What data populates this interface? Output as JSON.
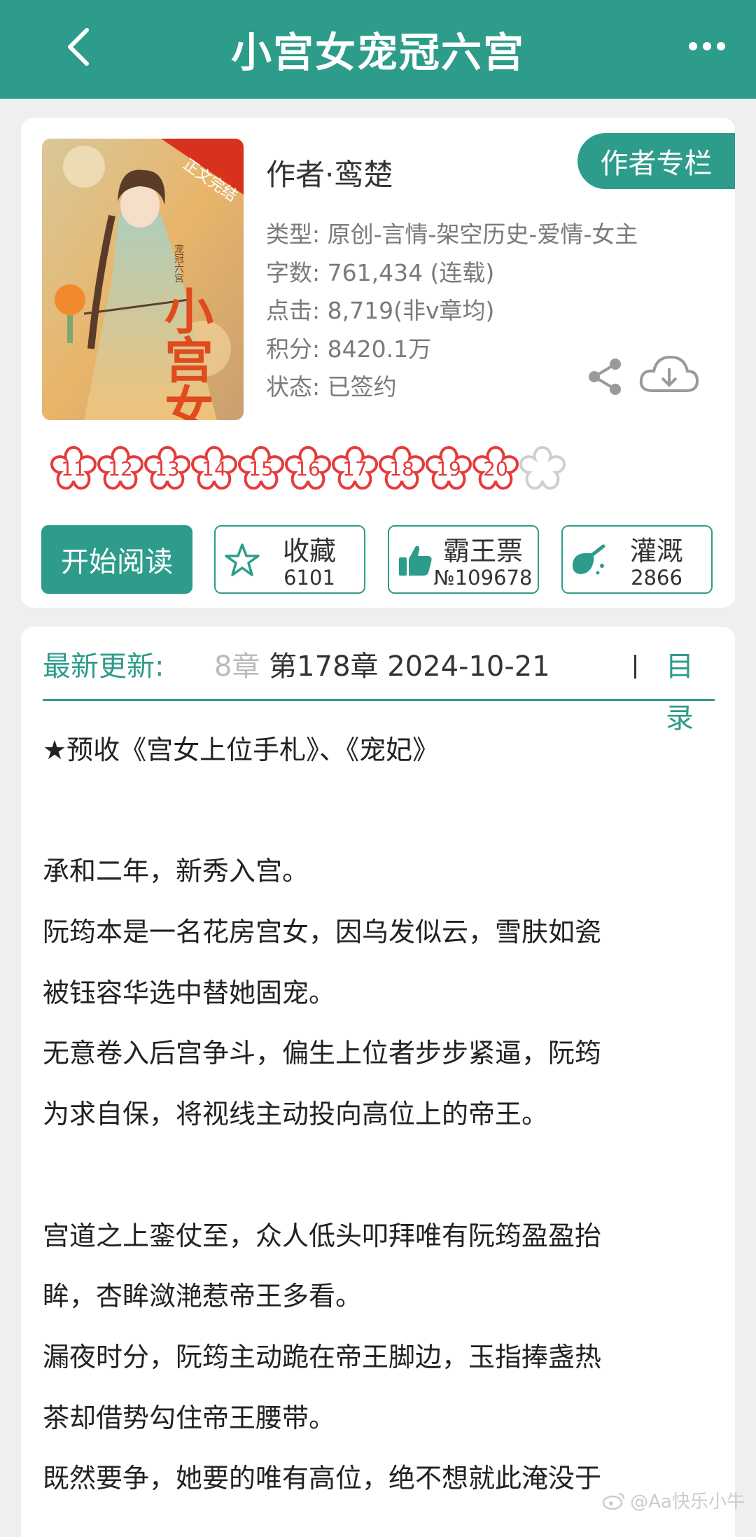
{
  "header": {
    "title": "小宫女宠冠六宫"
  },
  "book": {
    "cover_texts": [
      "正文完结",
      "小宫女",
      "宠冠六宫"
    ],
    "author": "作者·鸾楚",
    "author_column_button": "作者专栏",
    "meta": [
      "类型: 原创-言情-架空历史-爱情-女主",
      "字数: 761,434 (连载)",
      "点击: 8,719(非v章均)",
      "积分: 8420.1万",
      "状态: 已签约"
    ]
  },
  "flowers": [
    "11",
    "12",
    "13",
    "14",
    "15",
    "16",
    "17",
    "18",
    "19",
    "20"
  ],
  "actions": {
    "start_reading": "开始阅读",
    "collect": {
      "label": "收藏",
      "value": "6101"
    },
    "vote": {
      "label": "霸王票",
      "value": "№109678"
    },
    "water": {
      "label": "灌溉",
      "value": "2866"
    }
  },
  "latest": {
    "label": "最新更新:",
    "text_faded": "8章",
    "text": "第178章 2024-10-21",
    "toc": "目录"
  },
  "description": [
    "★预收《宫女上位手札》、《宠妃》",
    "",
    "承和二年，新秀入宫。",
    "阮筠本是一名花房宫女，因乌发似云，雪肤如瓷",
    "被钰容华选中替她固宠。",
    "无意卷入后宫争斗，偏生上位者步步紧逼，阮筠",
    "为求自保，将视线主动投向高位上的帝王。",
    "",
    "宫道之上銮仗至，众人低头叩拜唯有阮筠盈盈抬",
    "眸，杏眸潋滟惹帝王多看。",
    "漏夜时分，阮筠主动跪在帝王脚边，玉指捧盏热",
    "茶却借势勾住帝王腰带。",
    "既然要争，她要的唯有高位，绝不想就此淹没于"
  ],
  "watermark": "@Aa快乐小牛",
  "colors": {
    "accent": "#2d9c8b",
    "flower": "#e53b3b",
    "background": "#efefef"
  }
}
